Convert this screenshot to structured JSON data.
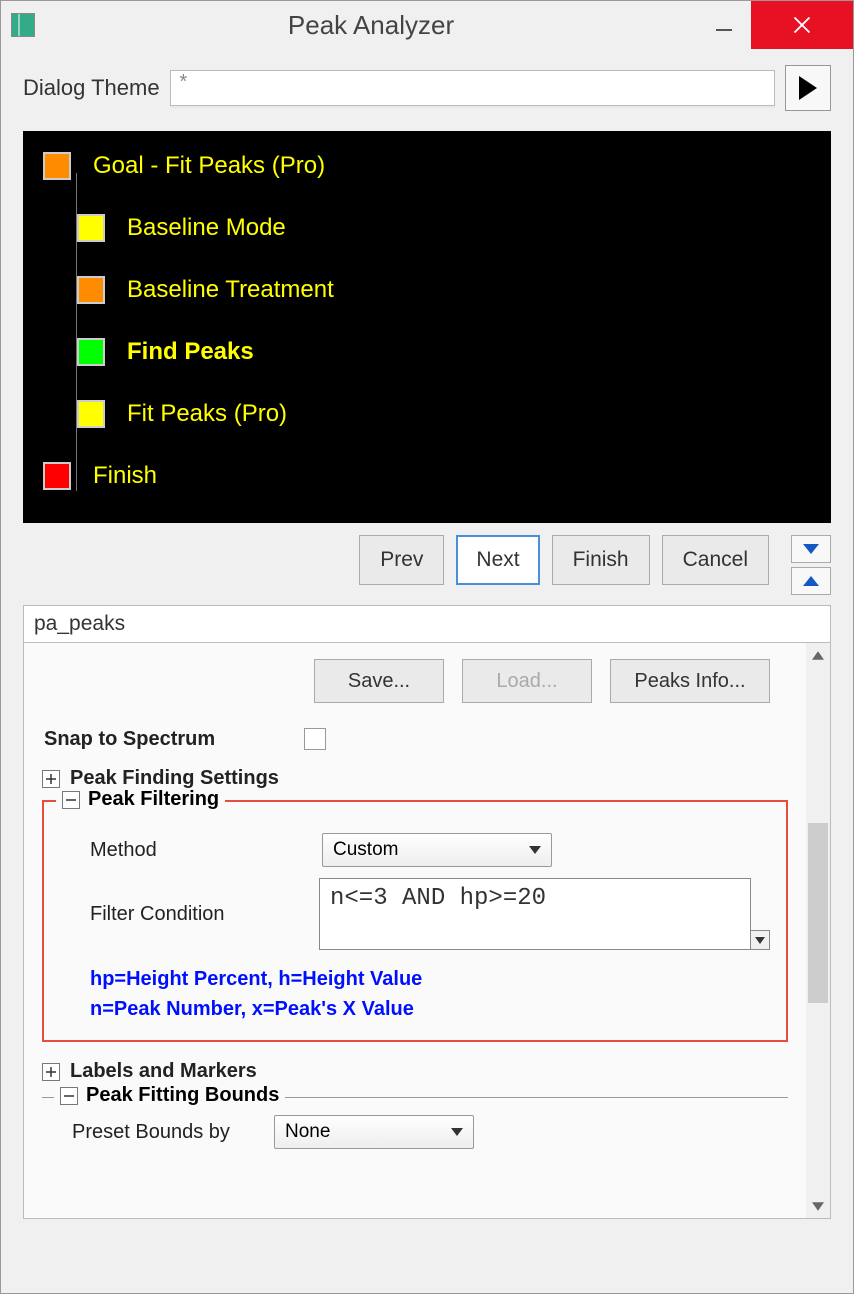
{
  "window": {
    "title": "Peak Analyzer"
  },
  "theme": {
    "label": "Dialog Theme",
    "value": "*"
  },
  "tree": {
    "items": [
      {
        "label": "Goal - Fit Peaks (Pro)",
        "color": "orange",
        "indent": false,
        "bold": false
      },
      {
        "label": "Baseline Mode",
        "color": "yellow",
        "indent": true,
        "bold": false
      },
      {
        "label": "Baseline Treatment",
        "color": "orange",
        "indent": true,
        "bold": false
      },
      {
        "label": "Find Peaks",
        "color": "green",
        "indent": true,
        "bold": true
      },
      {
        "label": "Fit Peaks (Pro)",
        "color": "yellow",
        "indent": true,
        "bold": false
      },
      {
        "label": "Finish",
        "color": "red",
        "indent": false,
        "bold": false
      }
    ]
  },
  "nav": {
    "prev": "Prev",
    "next": "Next",
    "finish": "Finish",
    "cancel": "Cancel"
  },
  "tab": {
    "label": "pa_peaks"
  },
  "toolbar": {
    "save": "Save...",
    "load": "Load...",
    "peaks_info": "Peaks Info..."
  },
  "snap": {
    "label": "Snap to Spectrum"
  },
  "peak_finding": {
    "label": "Peak Finding Settings"
  },
  "peak_filtering": {
    "label": "Peak Filtering",
    "method_label": "Method",
    "method_value": "Custom",
    "condition_label": "Filter Condition",
    "condition_value": "n<=3 AND hp>=20",
    "hint1": "hp=Height Percent, h=Height Value",
    "hint2": "n=Peak Number, x=Peak's X Value"
  },
  "labels_markers": {
    "label": "Labels and Markers"
  },
  "peak_bounds": {
    "label": "Peak Fitting Bounds",
    "preset_label": "Preset Bounds by",
    "preset_value": "None"
  }
}
